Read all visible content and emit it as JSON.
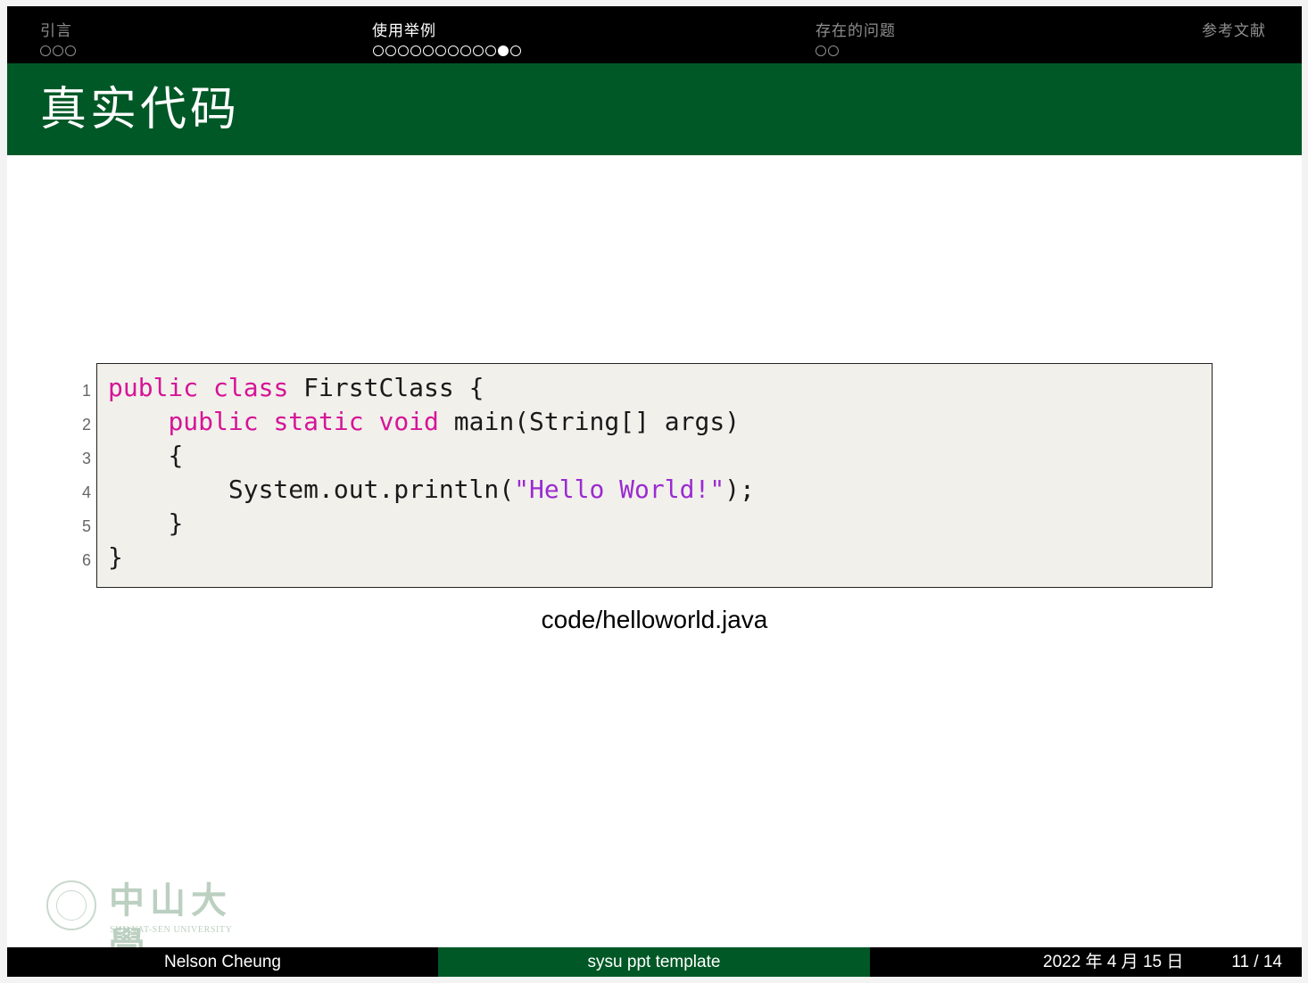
{
  "nav": {
    "sections": [
      {
        "label": "引言",
        "dots": 3,
        "filled": -1,
        "active": false
      },
      {
        "label": "使用举例",
        "dots": 12,
        "filled": 10,
        "active": true
      },
      {
        "label": "存在的问题",
        "dots": 2,
        "filled": -1,
        "active": false
      },
      {
        "label": "参考文献",
        "dots": 0,
        "filled": -1,
        "active": false
      }
    ]
  },
  "frame": {
    "title": "真实代码"
  },
  "code": {
    "line_numbers": [
      "1",
      "2",
      "3",
      "4",
      "5",
      "6"
    ],
    "lines": {
      "l1": {
        "kw1": "public",
        "kw2": "class",
        "rest": " FirstClass {"
      },
      "l2": {
        "kw1": "public",
        "kw2": "static",
        "kw3": "void",
        "rest": " main(String[] args)"
      },
      "l3": {
        "text": "{"
      },
      "l4": {
        "pre": "System.out.println(",
        "str1": "\"Hello",
        "str2": "World!\"",
        "post": ");"
      },
      "l5": {
        "text": "}"
      },
      "l6": {
        "text": "}"
      }
    },
    "caption": "code/helloworld.java"
  },
  "logo": {
    "chinese": "中山大學",
    "english": "SUN  YAT-SEN UNIVERSITY"
  },
  "footer": {
    "author": "Nelson Cheung",
    "title": "sysu ppt template",
    "date": "2022 年 4 月 15 日",
    "page": "11 / 14"
  }
}
